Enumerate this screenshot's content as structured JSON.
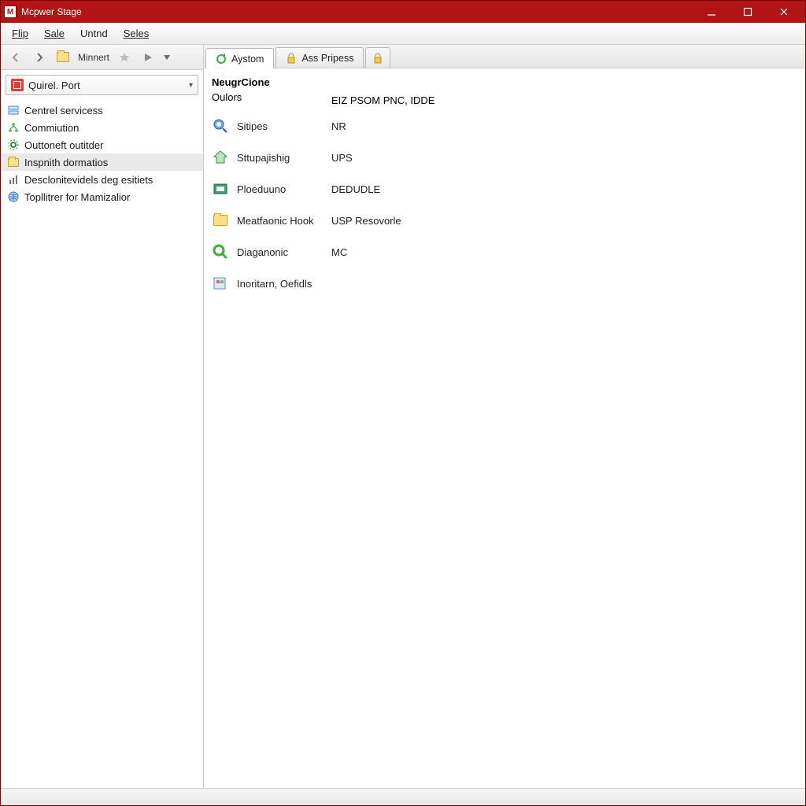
{
  "window": {
    "title": "Mcpwer Stage"
  },
  "menu": {
    "items": [
      "Flip",
      "Sale",
      "Untnd",
      "Seles"
    ]
  },
  "toolbar": {
    "address": "Minnert"
  },
  "sidebar": {
    "combo": {
      "label": "Quirel. Port"
    },
    "items": [
      {
        "label": "Centrel servicess"
      },
      {
        "label": "Commiution"
      },
      {
        "label": "Outtoneft outitder"
      },
      {
        "label": "Inspnith dormatios"
      },
      {
        "label": "Desclonitevidels deg esitiets"
      },
      {
        "label": "Topllitrer for Mamizalior"
      }
    ],
    "selected_index": 3
  },
  "tabs": {
    "items": [
      {
        "label": "Aystom"
      },
      {
        "label": "Ass Pripess"
      },
      {
        "label": ""
      }
    ],
    "active_index": 0
  },
  "page": {
    "heading": "NeugrCione",
    "subheading": "Oulors",
    "subheading_value": "EIZ PSOM PNC, IDDE",
    "rows": [
      {
        "label": "Sitipes",
        "value": "NR"
      },
      {
        "label": "Sttupajishig",
        "value": "UPS"
      },
      {
        "label": "Ploeduuno",
        "value": "DEDUDLE"
      },
      {
        "label": "Meatfaonic Hook",
        "value": "USP Resovorle"
      },
      {
        "label": "Diaganonic",
        "value": "MC"
      },
      {
        "label": "Inoritarn, Oefidls",
        "value": ""
      }
    ]
  }
}
